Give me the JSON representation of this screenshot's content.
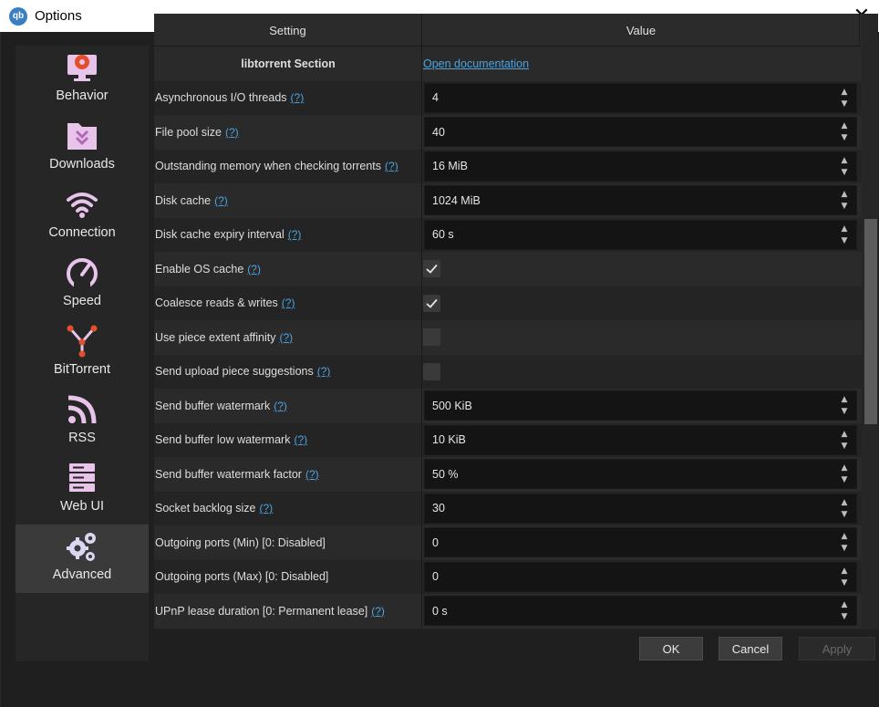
{
  "window": {
    "title": "Options",
    "app_icon_label": "qb"
  },
  "sidebar": {
    "items": [
      {
        "label": "Behavior",
        "icon": "monitor-gear-icon"
      },
      {
        "label": "Downloads",
        "icon": "folder-download-icon"
      },
      {
        "label": "Connection",
        "icon": "wifi-icon"
      },
      {
        "label": "Speed",
        "icon": "speedometer-icon"
      },
      {
        "label": "BitTorrent",
        "icon": "network-nodes-icon"
      },
      {
        "label": "RSS",
        "icon": "rss-icon"
      },
      {
        "label": "Web UI",
        "icon": "server-icon"
      },
      {
        "label": "Advanced",
        "icon": "gears-icon",
        "active": true
      }
    ]
  },
  "table": {
    "headers": {
      "setting": "Setting",
      "value": "Value"
    },
    "section": {
      "label": "libtorrent Section",
      "link": "Open documentation"
    },
    "help_text": "(?)",
    "rows": [
      {
        "label": "Asynchronous I/O threads",
        "help": true,
        "type": "spin",
        "value": "4"
      },
      {
        "label": "File pool size",
        "help": true,
        "type": "spin",
        "value": "40"
      },
      {
        "label": "Outstanding memory when checking torrents",
        "help": true,
        "type": "spin",
        "value": "16 MiB"
      },
      {
        "label": "Disk cache",
        "help": true,
        "type": "spin",
        "value": "1024 MiB"
      },
      {
        "label": "Disk cache expiry interval",
        "help": true,
        "type": "spin",
        "value": "60 s"
      },
      {
        "label": "Enable OS cache",
        "help": true,
        "type": "check",
        "checked": true
      },
      {
        "label": "Coalesce reads & writes",
        "help": true,
        "type": "check",
        "checked": true
      },
      {
        "label": "Use piece extent affinity",
        "help": true,
        "type": "check",
        "checked": false
      },
      {
        "label": "Send upload piece suggestions",
        "help": true,
        "type": "check",
        "checked": false
      },
      {
        "label": "Send buffer watermark",
        "help": true,
        "type": "spin",
        "value": "500 KiB"
      },
      {
        "label": "Send buffer low watermark",
        "help": true,
        "type": "spin",
        "value": "10 KiB"
      },
      {
        "label": "Send buffer watermark factor",
        "help": true,
        "type": "spin",
        "value": "50 %"
      },
      {
        "label": "Socket backlog size",
        "help": true,
        "type": "spin",
        "value": "30"
      },
      {
        "label": "Outgoing ports (Min) [0: Disabled]",
        "help": false,
        "type": "spin",
        "value": "0"
      },
      {
        "label": "Outgoing ports (Max) [0: Disabled]",
        "help": false,
        "type": "spin",
        "value": "0"
      },
      {
        "label": "UPnP lease duration [0: Permanent lease]",
        "help": true,
        "type": "spin",
        "value": "0 s"
      }
    ]
  },
  "buttons": {
    "ok": "OK",
    "cancel": "Cancel",
    "apply": "Apply"
  },
  "colors": {
    "link": "#4aa3e0",
    "icon": "#e8c3ea",
    "accent": "#e2502a"
  }
}
